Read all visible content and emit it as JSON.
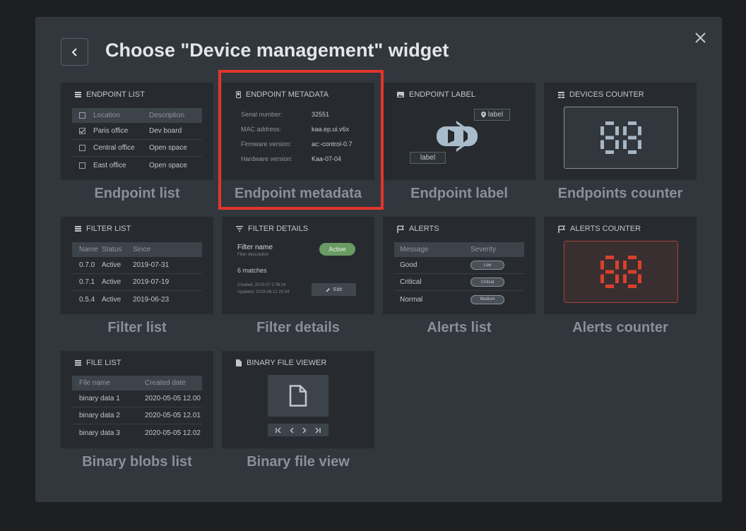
{
  "modal": {
    "title": "Choose \"Device management\" widget"
  },
  "colors": {
    "accent_highlight": "#e2352b",
    "active_badge": "#6a9b62",
    "counter_red": "#d9412c",
    "counter_blue": "#a7b7c6"
  },
  "tiles": {
    "endpoint_list": {
      "header": "ENDPOINT LIST",
      "label": "Endpoint list",
      "columns": [
        "Location",
        "Description"
      ],
      "rows": [
        {
          "location": "Paris office",
          "description": "Dev board",
          "checked": true
        },
        {
          "location": "Central office",
          "description": "Open space",
          "checked": false
        },
        {
          "location": "East office",
          "description": "Open space",
          "checked": false
        }
      ]
    },
    "endpoint_metadata": {
      "header": "ENDPOINT METADATA",
      "label": "Endpoint metadata",
      "rows": [
        {
          "key": "Serial number:",
          "value": "32551"
        },
        {
          "key": "MAC address:",
          "value": "kaa.ep.ui.v6x"
        },
        {
          "key": "Firmware version:",
          "value": "ac:-control-0.7"
        },
        {
          "key": "Hardware version:",
          "value": "Kaa-07-04"
        }
      ]
    },
    "endpoint_label": {
      "header": "ENDPOINT LABEL",
      "label": "Endpoint label",
      "tag_top": "label",
      "tag_bottom": "label"
    },
    "devices_counter": {
      "header": "DEVICES COUNTER",
      "label": "Endpoints counter",
      "display": "88"
    },
    "filter_list": {
      "header": "FILTER LIST",
      "label": "Filter list",
      "columns": [
        "Name",
        "Status",
        "Since"
      ],
      "rows": [
        {
          "name": "0.7.0",
          "status": "Active",
          "since": "2019-07-31"
        },
        {
          "name": "0.7.1",
          "status": "Active",
          "since": "2019-07-19"
        },
        {
          "name": "0.5.4",
          "status": "Active",
          "since": "2019-06-23"
        }
      ]
    },
    "filter_details": {
      "header": "FILTER DETAILS",
      "label": "Filter details",
      "name": "Filter name",
      "description": "Filter description",
      "badge": "Active",
      "matches": "6 matches",
      "created": "Created:   2019-07-2 06:24",
      "updated": "Updated:   2019-08-12 20:34",
      "edit": "Edit"
    },
    "alerts": {
      "header": "ALERTS",
      "label": "Alerts list",
      "columns": [
        "Message",
        "Severity"
      ],
      "rows": [
        {
          "message": "Good",
          "severity": "Low"
        },
        {
          "message": "Critical",
          "severity": "Critical"
        },
        {
          "message": "Normal",
          "severity": "Medium"
        }
      ]
    },
    "alerts_counter": {
      "header": "ALERTS COUNTER",
      "label": "Alerts counter",
      "display": "88"
    },
    "file_list": {
      "header": "FILE LIST",
      "label": "Binary blobs list",
      "columns": [
        "File name",
        "Created date"
      ],
      "rows": [
        {
          "name": "binary data 1",
          "date": "2020-05-05  12.00"
        },
        {
          "name": "binary data 2",
          "date": "2020-05-05  12.01"
        },
        {
          "name": "binary data 3",
          "date": "2020-05-05  12.02"
        }
      ]
    },
    "binary_file_viewer": {
      "header": "BINARY FILE VIEWER",
      "label": "Binary file view"
    }
  }
}
